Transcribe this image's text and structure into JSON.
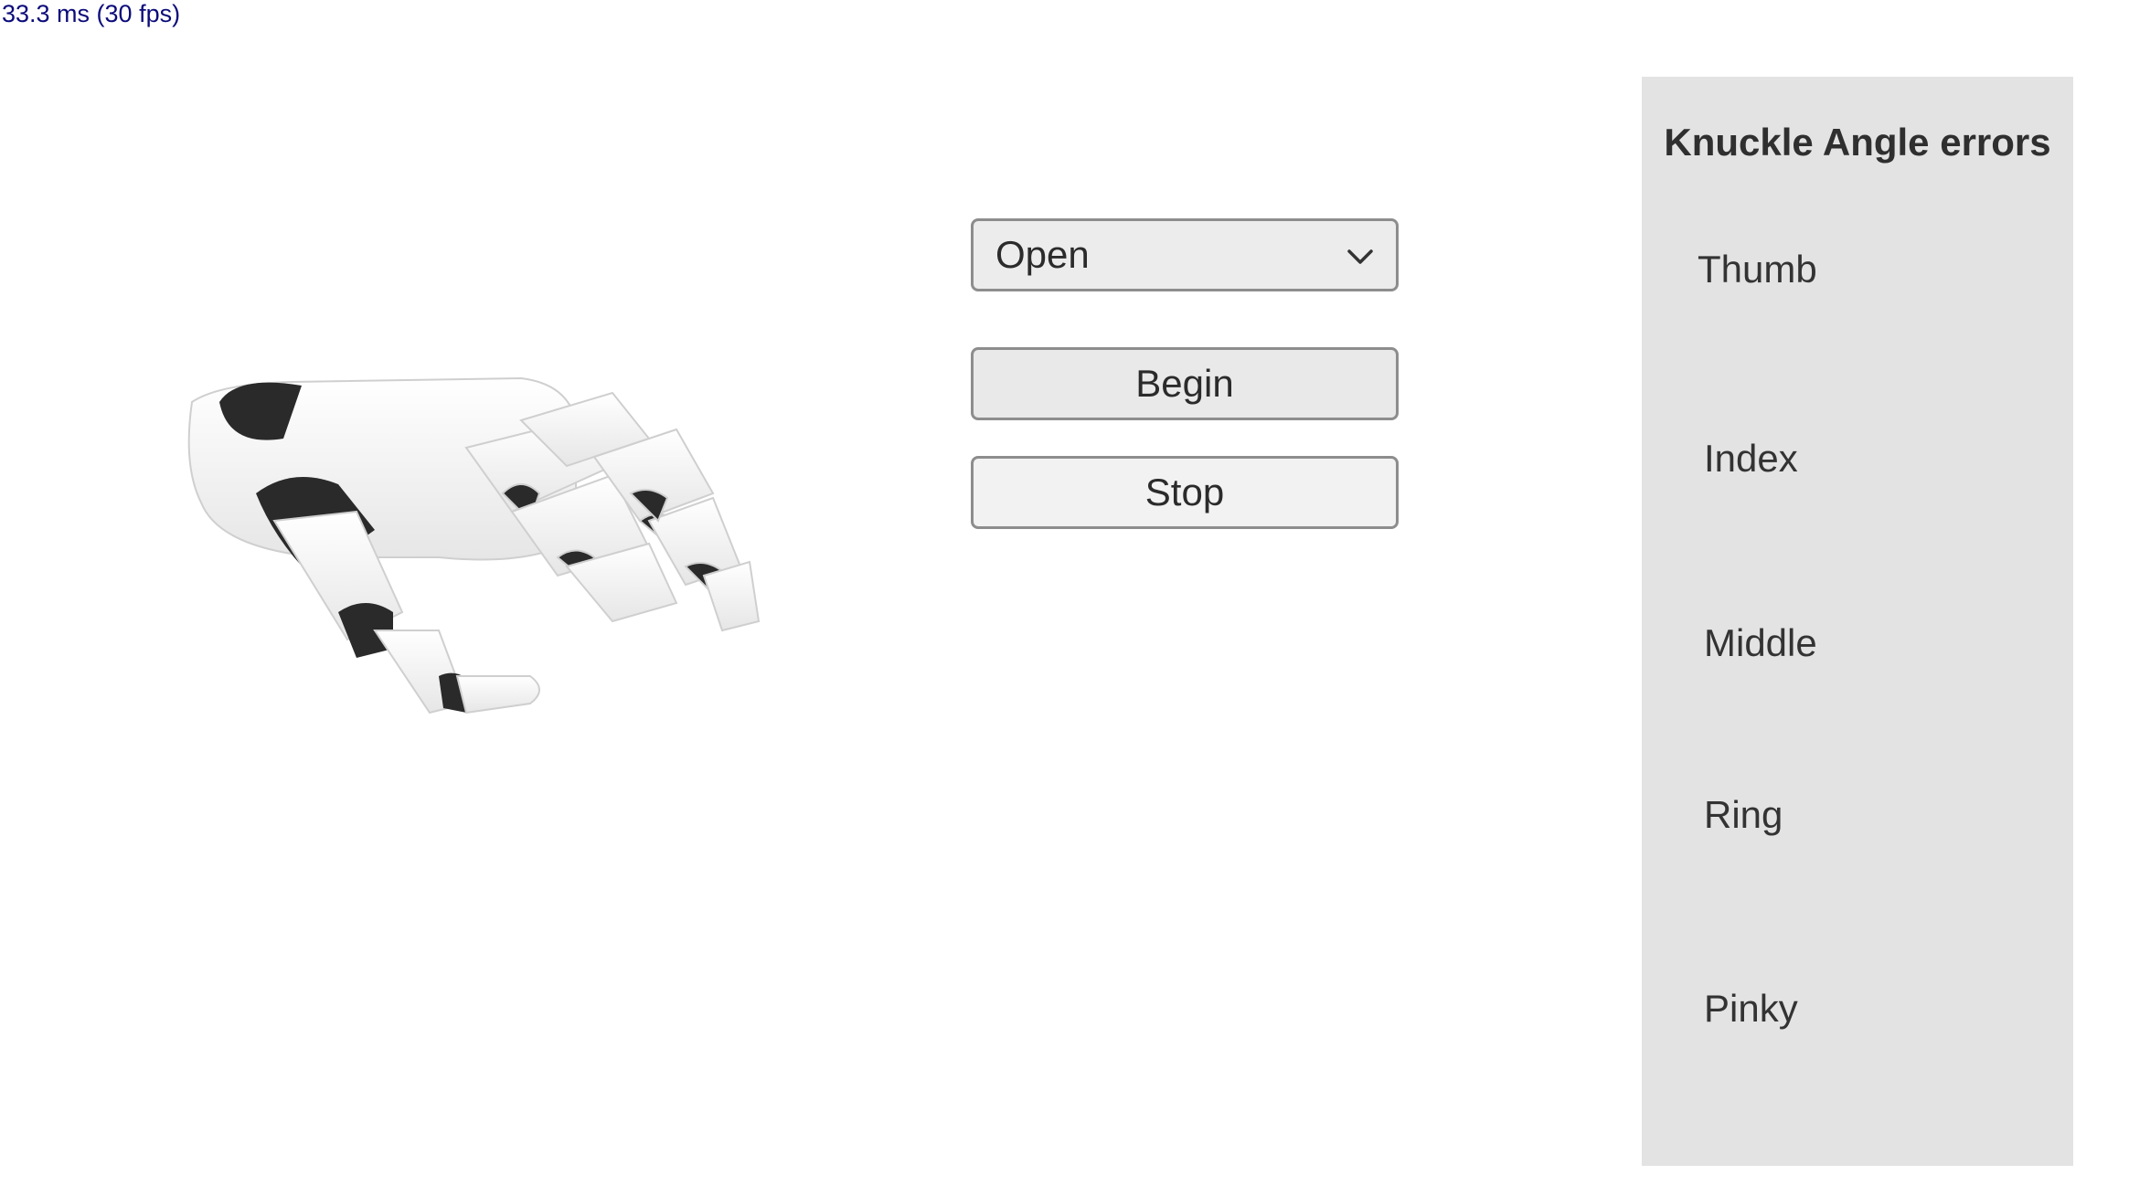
{
  "frame_stats": "33.3 ms (30 fps)",
  "controls": {
    "pose_select": {
      "value": "Open",
      "icon": "chevron-down-icon"
    },
    "begin_label": "Begin",
    "stop_label": "Stop"
  },
  "errors_panel": {
    "title": "Knuckle Angle errors",
    "fingers": [
      "Thumb",
      "Index",
      "Middle",
      "Ring",
      "Pinky"
    ]
  },
  "colors": {
    "panel_bg": "#e3e3e3",
    "fps_text": "#0c0c7a",
    "hand_shell": "#ffffff",
    "hand_joint": "#2a2a2a"
  }
}
